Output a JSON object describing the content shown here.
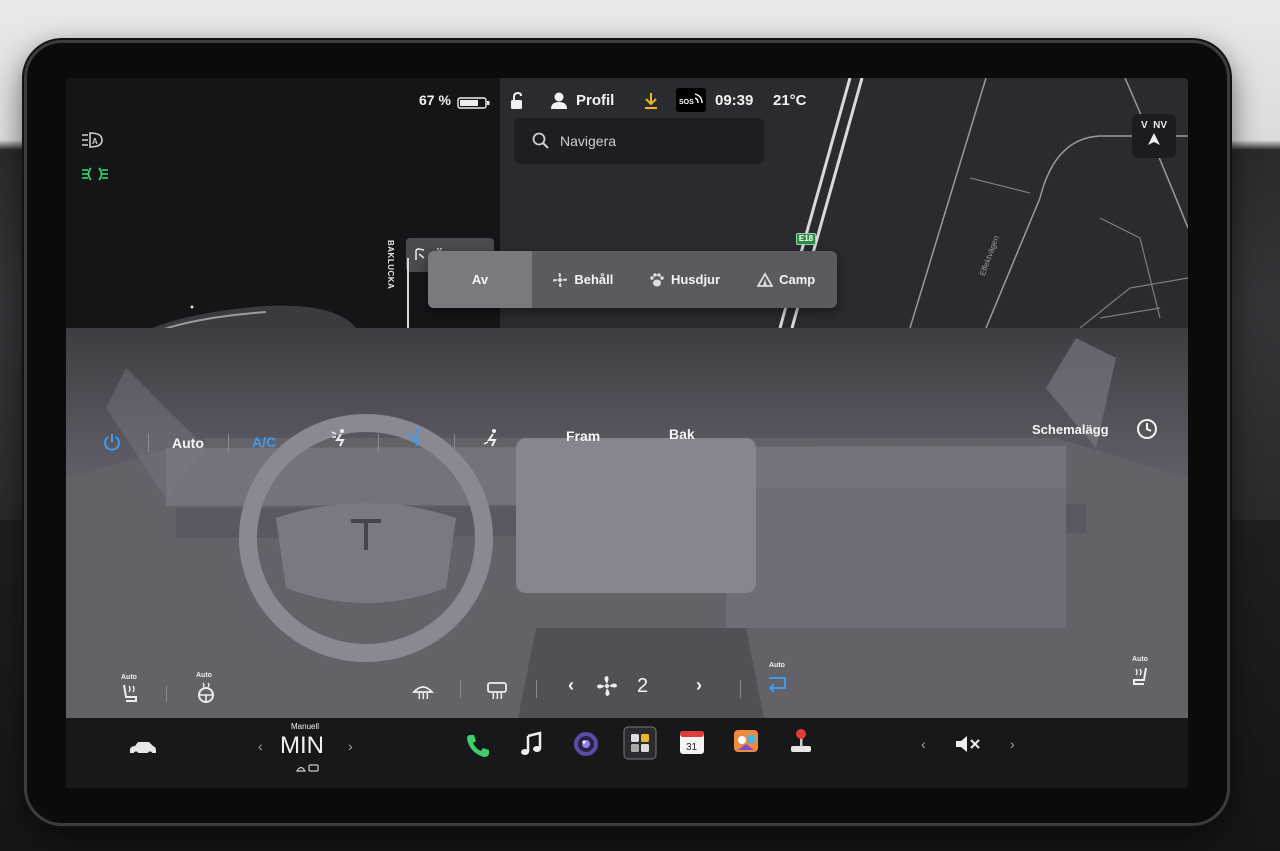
{
  "status_bar": {
    "battery": "67 %",
    "profile": "Profil",
    "sos": "SOS",
    "time": "09:39",
    "temperature": "21°C"
  },
  "map": {
    "search_placeholder": "Navigera",
    "compass": "V  NV",
    "highway_shield": "E18",
    "road_name": "Effektvägen"
  },
  "trunk": {
    "label": "BAKLUCKA",
    "open_label": "Öppna"
  },
  "climate_modes": [
    {
      "label": "Av",
      "active": true
    },
    {
      "label": "Behåll",
      "icon": "fan-keep-icon"
    },
    {
      "label": "Husdjur",
      "icon": "paw-icon"
    },
    {
      "label": "Camp",
      "icon": "tent-icon"
    }
  ],
  "climate_bar": {
    "auto": "Auto",
    "ac": "A/C",
    "front": "Fram",
    "rear": "Bak",
    "schedule": "Schemalägg"
  },
  "climate_bottom": {
    "seat_left_auto": "Auto",
    "wheel_auto": "Auto",
    "fan_speed": "2",
    "recirc_auto": "Auto",
    "seat_right_auto": "Auto"
  },
  "dock": {
    "temp_mode": "Manuell",
    "temp_value": "MIN",
    "calendar_day": "31"
  },
  "colors": {
    "accent_blue": "#3d9cf0",
    "phone_green": "#3fcf6a",
    "headlight_green": "#35d36a"
  }
}
